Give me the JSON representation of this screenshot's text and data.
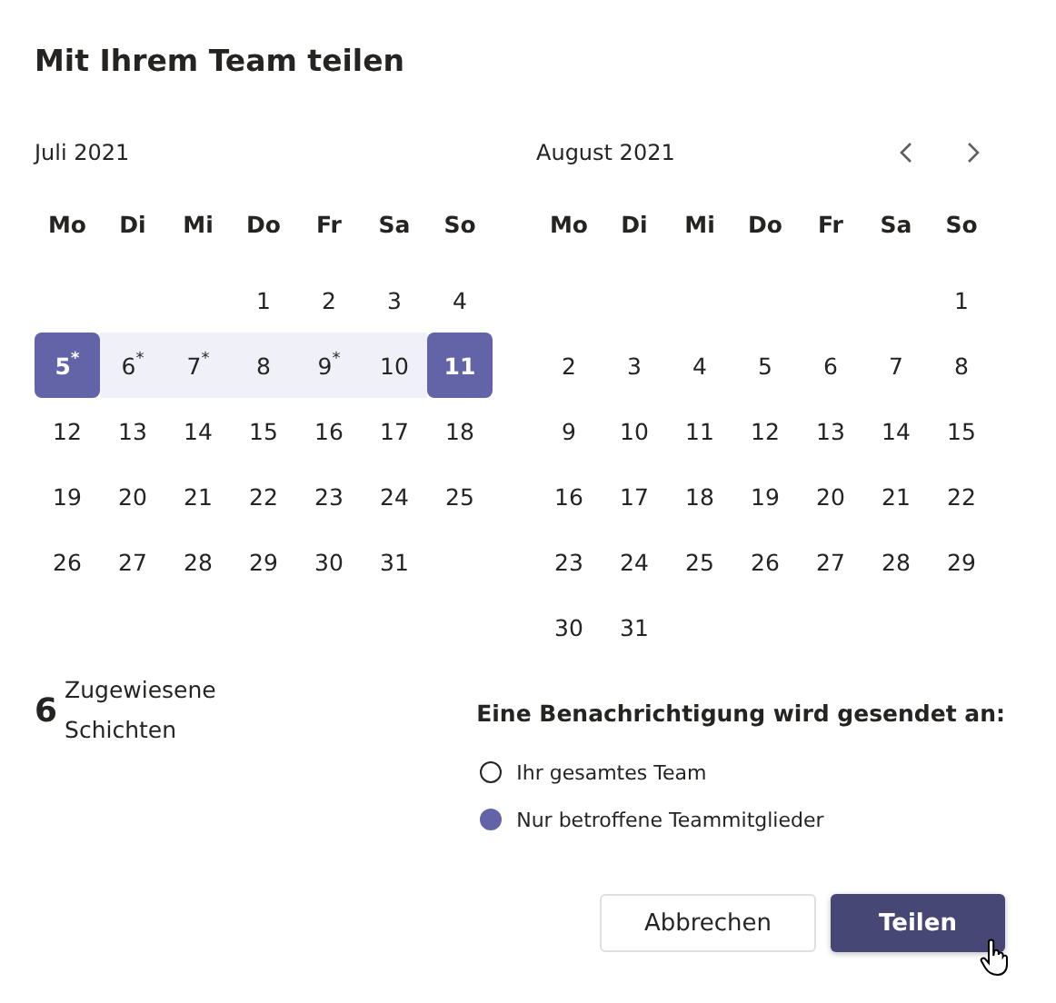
{
  "title": "Mit Ihrem Team teilen",
  "months": [
    {
      "title": "Juli 2021",
      "weekdays": [
        "Mo",
        "Di",
        "Mi",
        "Do",
        "Fr",
        "Sa",
        "So"
      ],
      "weeks": [
        [
          {
            "kind": "blank"
          },
          {
            "kind": "blank"
          },
          {
            "kind": "blank"
          },
          {
            "kind": "day",
            "label": "1",
            "selected": false,
            "in_range": false
          },
          {
            "kind": "day",
            "label": "2",
            "selected": false,
            "in_range": false
          },
          {
            "kind": "day",
            "label": "3",
            "selected": false,
            "in_range": false
          },
          {
            "kind": "day",
            "label": "4",
            "selected": false,
            "in_range": false
          }
        ],
        [
          {
            "kind": "day",
            "label": "5$^{*}$",
            "selected": true,
            "in_range": true
          },
          {
            "kind": "day",
            "label": "6$^{*}$",
            "selected": false,
            "in_range": true
          },
          {
            "kind": "day",
            "label": "7$^{*}$",
            "selected": false,
            "in_range": true
          },
          {
            "kind": "day",
            "label": "8",
            "selected": false,
            "in_range": true
          },
          {
            "kind": "day",
            "label": "9$^{*}$",
            "selected": false,
            "in_range": true
          },
          {
            "kind": "day",
            "label": "10",
            "selected": false,
            "in_range": true
          },
          {
            "kind": "day",
            "label": "11",
            "selected": true,
            "in_range": true
          }
        ],
        [
          {
            "kind": "day",
            "label": "12",
            "selected": false,
            "in_range": false
          },
          {
            "kind": "day",
            "label": "13",
            "selected": false,
            "in_range": false
          },
          {
            "kind": "day",
            "label": "14",
            "selected": false,
            "in_range": false
          },
          {
            "kind": "day",
            "label": "15",
            "selected": false,
            "in_range": false
          },
          {
            "kind": "day",
            "label": "16",
            "selected": false,
            "in_range": false
          },
          {
            "kind": "day",
            "label": "17",
            "selected": false,
            "in_range": false
          },
          {
            "kind": "day",
            "label": "18",
            "selected": false,
            "in_range": false
          }
        ],
        [
          {
            "kind": "day",
            "label": "19",
            "selected": false,
            "in_range": false
          },
          {
            "kind": "day",
            "label": "20",
            "selected": false,
            "in_range": false
          },
          {
            "kind": "day",
            "label": "21",
            "selected": false,
            "in_range": false
          },
          {
            "kind": "day",
            "label": "22",
            "selected": false,
            "in_range": false
          },
          {
            "kind": "day",
            "label": "23",
            "selected": false,
            "in_range": false
          },
          {
            "kind": "day",
            "label": "24",
            "selected": false,
            "in_range": false
          },
          {
            "kind": "day",
            "label": "25",
            "selected": false,
            "in_range": false
          }
        ],
        [
          {
            "kind": "day",
            "label": "26",
            "selected": false,
            "in_range": false
          },
          {
            "kind": "day",
            "label": "27",
            "selected": false,
            "in_range": false
          },
          {
            "kind": "day",
            "label": "28",
            "selected": false,
            "in_range": false
          },
          {
            "kind": "day",
            "label": "29",
            "selected": false,
            "in_range": false
          },
          {
            "kind": "day",
            "label": "30",
            "selected": false,
            "in_range": false
          },
          {
            "kind": "day",
            "label": "31",
            "selected": false,
            "in_range": false
          },
          {
            "kind": "blank"
          }
        ]
      ]
    },
    {
      "title": "August 2021",
      "weekdays": [
        "Mo",
        "Di",
        "Mi",
        "Do",
        "Fr",
        "Sa",
        "So"
      ],
      "weeks": [
        [
          {
            "kind": "blank"
          },
          {
            "kind": "blank"
          },
          {
            "kind": "blank"
          },
          {
            "kind": "blank"
          },
          {
            "kind": "blank"
          },
          {
            "kind": "blank"
          },
          {
            "kind": "day",
            "label": "1",
            "selected": false,
            "in_range": false
          }
        ],
        [
          {
            "kind": "day",
            "label": "2",
            "selected": false,
            "in_range": false
          },
          {
            "kind": "day",
            "label": "3",
            "selected": false,
            "in_range": false
          },
          {
            "kind": "day",
            "label": "4",
            "selected": false,
            "in_range": false
          },
          {
            "kind": "day",
            "label": "5",
            "selected": false,
            "in_range": false
          },
          {
            "kind": "day",
            "label": "6",
            "selected": false,
            "in_range": false
          },
          {
            "kind": "day",
            "label": "7",
            "selected": false,
            "in_range": false
          },
          {
            "kind": "day",
            "label": "8",
            "selected": false,
            "in_range": false
          }
        ],
        [
          {
            "kind": "day",
            "label": "9",
            "selected": false,
            "in_range": false
          },
          {
            "kind": "day",
            "label": "10",
            "selected": false,
            "in_range": false
          },
          {
            "kind": "day",
            "label": "11",
            "selected": false,
            "in_range": false
          },
          {
            "kind": "day",
            "label": "12",
            "selected": false,
            "in_range": false
          },
          {
            "kind": "day",
            "label": "13",
            "selected": false,
            "in_range": false
          },
          {
            "kind": "day",
            "label": "14",
            "selected": false,
            "in_range": false
          },
          {
            "kind": "day",
            "label": "15",
            "selected": false,
            "in_range": false
          }
        ],
        [
          {
            "kind": "day",
            "label": "16",
            "selected": false,
            "in_range": false
          },
          {
            "kind": "day",
            "label": "17",
            "selected": false,
            "in_range": false
          },
          {
            "kind": "day",
            "label": "18",
            "selected": false,
            "in_range": false
          },
          {
            "kind": "day",
            "label": "19",
            "selected": false,
            "in_range": false
          },
          {
            "kind": "day",
            "label": "20",
            "selected": false,
            "in_range": false
          },
          {
            "kind": "day",
            "label": "21",
            "selected": false,
            "in_range": false
          },
          {
            "kind": "day",
            "label": "22",
            "selected": false,
            "in_range": false
          }
        ],
        [
          {
            "kind": "day",
            "label": "23",
            "selected": false,
            "in_range": false
          },
          {
            "kind": "day",
            "label": "24",
            "selected": false,
            "in_range": false
          },
          {
            "kind": "day",
            "label": "25",
            "selected": false,
            "in_range": false
          },
          {
            "kind": "day",
            "label": "26",
            "selected": false,
            "in_range": false
          },
          {
            "kind": "day",
            "label": "27",
            "selected": false,
            "in_range": false
          },
          {
            "kind": "day",
            "label": "28",
            "selected": false,
            "in_range": false
          },
          {
            "kind": "day",
            "label": "29",
            "selected": false,
            "in_range": false
          }
        ],
        [
          {
            "kind": "day",
            "label": "30",
            "selected": false,
            "in_range": false
          },
          {
            "kind": "day",
            "label": "31",
            "selected": false,
            "in_range": false
          },
          {
            "kind": "blank"
          },
          {
            "kind": "blank"
          },
          {
            "kind": "blank"
          },
          {
            "kind": "blank"
          },
          {
            "kind": "blank"
          }
        ]
      ]
    }
  ],
  "summary": {
    "count": "6",
    "label": "Zugewiesene Schichten"
  },
  "notify": {
    "heading": "Eine Benachrichtigung wird gesendet an:",
    "options": [
      {
        "label": "Ihr gesamtes Team",
        "selected": false
      },
      {
        "label": "Nur betroffene Teammitglieder",
        "selected": true
      }
    ]
  },
  "buttons": [
    {
      "label": "Abbrechen",
      "kind": "secondary"
    },
    {
      "label": "Teilen",
      "kind": "primary",
      "hovered": true
    }
  ]
}
